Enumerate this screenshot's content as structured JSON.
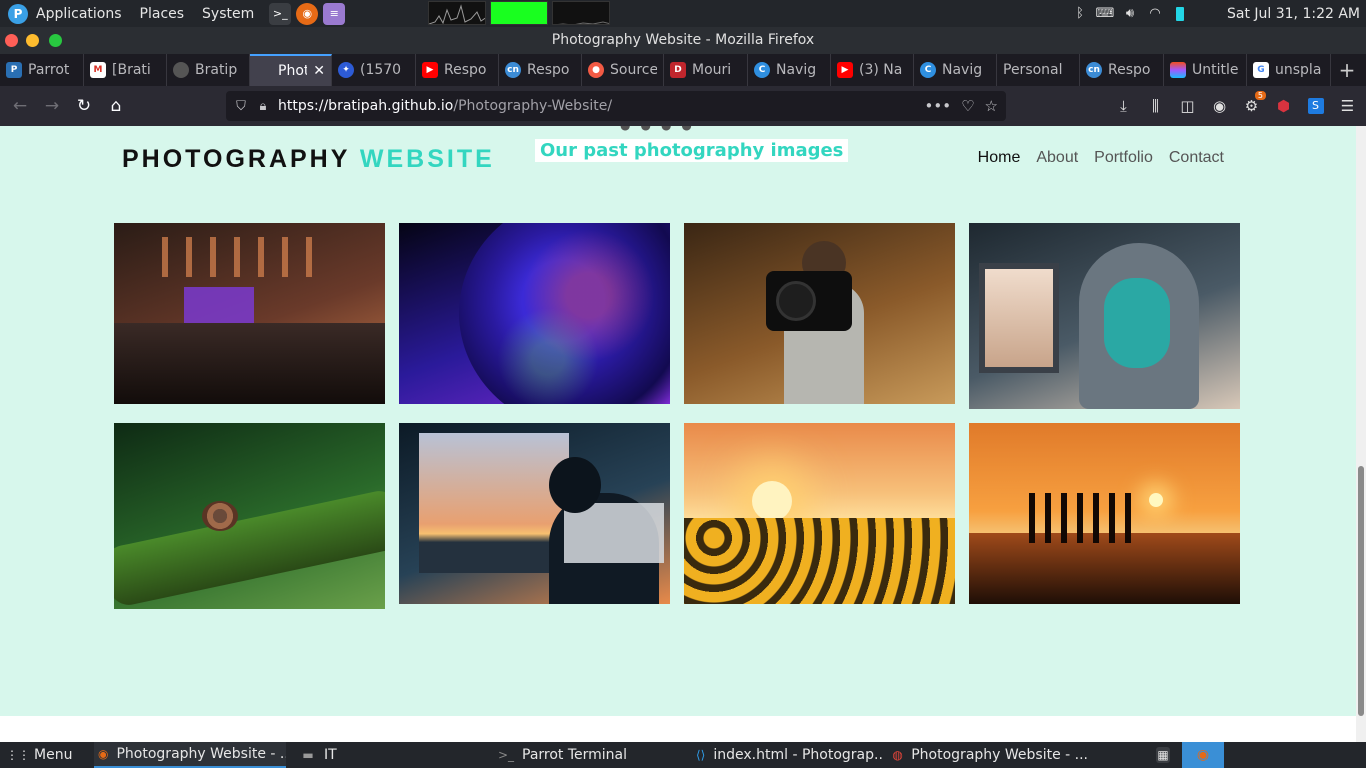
{
  "system_panel": {
    "menus": [
      "Applications",
      "Places",
      "System"
    ],
    "clock": "Sat Jul 31,  1:22 AM"
  },
  "window": {
    "title": "Photography Website - Mozilla Firefox"
  },
  "tabs": [
    {
      "label": "Parrot",
      "icon": "parrot-icon",
      "color": "#2a6fb3"
    },
    {
      "label": "[Brati",
      "icon": "gmail-icon",
      "color": "#d93025"
    },
    {
      "label": "Bratip",
      "icon": "github-icon",
      "color": "#333333"
    },
    {
      "label": "Photo",
      "icon": "page-icon",
      "color": "#42414d",
      "active": true
    },
    {
      "label": "(1570",
      "icon": "compass-icon",
      "color": "#2d5bd6"
    },
    {
      "label": "Respo",
      "icon": "youtube-icon",
      "color": "#ff0000"
    },
    {
      "label": "Respo",
      "icon": "cn-icon",
      "color": "#3c8cd6"
    },
    {
      "label": "Source",
      "icon": "patreon-icon",
      "color": "#f25a44"
    },
    {
      "label": "Mouri",
      "icon": "d-icon",
      "color": "#c0262d"
    },
    {
      "label": "Navig",
      "icon": "c-icon",
      "color": "#2f8fe0"
    },
    {
      "label": "(3) Na",
      "icon": "youtube-icon",
      "color": "#ff0000"
    },
    {
      "label": "Navig",
      "icon": "c-icon",
      "color": "#2f8fe0"
    },
    {
      "label": "Personal",
      "icon": "",
      "color": ""
    },
    {
      "label": "Respo",
      "icon": "cn-icon",
      "color": "#3c8cd6"
    },
    {
      "label": "Untitle",
      "icon": "figma-icon",
      "color": "#a259ff"
    },
    {
      "label": "unspla",
      "icon": "google-icon",
      "color": "#ffffff"
    }
  ],
  "urlbar": {
    "host": "https://bratipah.github.io",
    "path": "/Photography-Website/"
  },
  "toolbar": {
    "addon_badge": "5"
  },
  "page": {
    "logo_main": "PHOTOGRAPHY",
    "logo_accent": "WEBSITE",
    "section_title": "Our past photography images",
    "nav": [
      "Home",
      "About",
      "Portfolio",
      "Contact"
    ],
    "colors": {
      "background": "#d7f7ec",
      "accent": "#33d6c0"
    },
    "photos": [
      {
        "name": "photo-music-studio",
        "colors": [
          "#2a1c16",
          "#6a3a2a",
          "#c97a4a"
        ]
      },
      {
        "name": "photo-glitter-face",
        "colors": [
          "#050414",
          "#2a1a9a",
          "#7a2ad0"
        ]
      },
      {
        "name": "photo-camera-toss",
        "colors": [
          "#3a2614",
          "#8a5a2a",
          "#c89a5a"
        ]
      },
      {
        "name": "photo-masked-hoodie",
        "colors": [
          "#1e2830",
          "#4a5a66",
          "#d8c8b8"
        ]
      },
      {
        "name": "photo-snail-branch",
        "colors": [
          "#0e2a14",
          "#2a6a2a",
          "#6aa04a"
        ]
      },
      {
        "name": "photo-sunset-office",
        "colors": [
          "#0c1a26",
          "#274256",
          "#e88a4a"
        ]
      },
      {
        "name": "photo-sunflowers",
        "colors": [
          "#3a2a0e",
          "#c0681e",
          "#f4b040"
        ]
      },
      {
        "name": "photo-beach-jump",
        "colors": [
          "#1e0e06",
          "#a0441a",
          "#f09038"
        ]
      }
    ]
  },
  "taskbar": {
    "menu": "Menu",
    "items": [
      {
        "label": "Photography Website - ...",
        "icon": "firefox-icon",
        "active": true
      },
      {
        "label": "IT",
        "icon": "folder-icon"
      },
      {
        "label": "Parrot Terminal",
        "icon": "terminal-icon"
      },
      {
        "label": "index.html - Photograp...",
        "icon": "vscode-icon"
      },
      {
        "label": "Photography Website - ...",
        "icon": "chrome-icon"
      }
    ]
  }
}
